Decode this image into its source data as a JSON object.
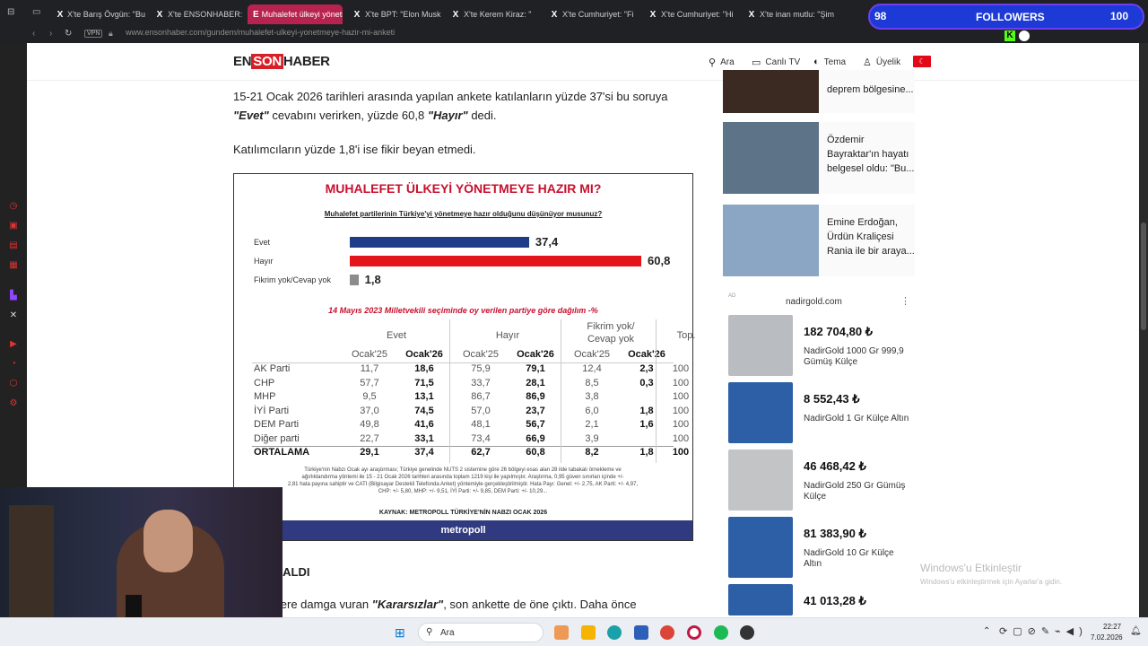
{
  "tabs": [
    {
      "label": "X'te Barış Övgün: \"Bu",
      "icon": "X",
      "active": false
    },
    {
      "label": "X'te ENSONHABER:",
      "icon": "X",
      "active": false
    },
    {
      "label": "Muhalefet ülkeyi yönetm",
      "icon": "E",
      "active": true
    },
    {
      "label": "X'te BPT: \"Elon Musk",
      "icon": "X",
      "active": false
    },
    {
      "label": "X'te Kerem Kiraz: \"",
      "icon": "X",
      "active": false
    },
    {
      "label": "X'te Cumhuriyet: \"Fi",
      "icon": "X",
      "active": false
    },
    {
      "label": "X'te Cumhuriyet: \"Hi",
      "icon": "X",
      "active": false
    },
    {
      "label": "X'te inan mutlu: \"Şim",
      "icon": "X",
      "active": false
    }
  ],
  "address": {
    "vpn": "VPN",
    "url": "www.ensonhaber.com/gundem/muhalefet-ulkeyi-yonetmeye-hazir-mi-anketi"
  },
  "header": {
    "logo": {
      "part1": "EN",
      "part2": "SON",
      "part3": "HABER"
    },
    "nav": [
      {
        "icon": "search-icon",
        "glyph": "⚲",
        "label": "Ara"
      },
      {
        "icon": "tv-icon",
        "glyph": "▭",
        "label": "Canlı TV"
      },
      {
        "icon": "theme-icon",
        "glyph": "◐",
        "label": "Tema"
      },
      {
        "icon": "user-icon",
        "glyph": "♙",
        "label": "Üyelik"
      }
    ],
    "flag": "☾"
  },
  "article": {
    "p1_line1": "15-21 Ocak 2026 tarihleri arasında yapılan ankete katılanların yüzde 37'si bu soruya",
    "p1_yes": "\"Evet\"",
    "p1_mid": " cevabını verirken, yüzde 60,8 ",
    "p1_no": "\"Hayır\"",
    "p1_end": " dedi.",
    "p2": "Katılımcıların yüzde 1,8'i ise fikir beyan etmedi.",
    "subhead": "ZLAR AZALDI",
    "p3_start": "an anketlere damga vuran ",
    "p3_bold": "\"Kararsızlar\"",
    "p3_end": ", son ankette de öne çıktı. Daha önce"
  },
  "figure": {
    "title": "MUHALEFET ÜLKEYİ YÖNETMEYE HAZIR MI?",
    "question": "Muhalefet partilerinin Türkiye'yi yönetmeye hazır olduğunu düşünüyor musunuz?",
    "subtitle": "14 Mayıs 2023 Milletvekili seçiminde oy verilen partiye göre dağılım -%",
    "groups": [
      "Evet",
      "Hayır",
      "Fikrim yok/\nCevap yok",
      "Top."
    ],
    "cols": [
      "Ocak'25",
      "Ocak'26",
      "Ocak'25",
      "Ocak'26",
      "Ocak'25",
      "Ocak'26"
    ],
    "rows": [
      {
        "label": "AK Parti",
        "values": [
          "11,7",
          "18,6",
          "75,9",
          "79,1",
          "12,4",
          "2,3",
          "100"
        ]
      },
      {
        "label": "CHP",
        "values": [
          "57,7",
          "71,5",
          "33,7",
          "28,1",
          "8,5",
          "0,3",
          "100"
        ]
      },
      {
        "label": "MHP",
        "values": [
          "9,5",
          "13,1",
          "86,7",
          "86,9",
          "3,8",
          "",
          "100"
        ]
      },
      {
        "label": "İYİ Parti",
        "values": [
          "37,0",
          "74,5",
          "57,0",
          "23,7",
          "6,0",
          "1,8",
          "100"
        ]
      },
      {
        "label": "DEM Parti",
        "values": [
          "49,8",
          "41,6",
          "48,1",
          "56,7",
          "2,1",
          "1,6",
          "100"
        ]
      },
      {
        "label": "Diğer parti",
        "values": [
          "22,7",
          "33,1",
          "73,4",
          "66,9",
          "3,9",
          "",
          "100"
        ]
      },
      {
        "label": "ORTALAMA",
        "values": [
          "29,1",
          "37,4",
          "62,7",
          "60,8",
          "8,2",
          "1,8",
          "100"
        ]
      }
    ],
    "note_line1": "Türkiye'nin Nabzı Ocak ayı araştırması; Türkiye genelinde NUTS 2 sistemine göre 26 bölgeyi esas alan 28 ilde tabakalı örnekleme ve",
    "note_line2": "ağırlıklandırma yöntemi ile 15 - 21 Ocak 2026 tarihleri arasında toplam 1219 kişi ile yapılmıştır. Araştırma, 0,95 güven sınırları içinde +/-",
    "note_line3": "2,81 hata payına sahiptir ve CATI (Bilgisayar Destekli Telefonda Anket) yöntemiyle gerçekleştirilmiştir. Hata Payı: Genel: +/- 2,75, AK Parti: +/- 4,97,",
    "note_line4": "CHP: +/- 5,80, MHP: +/- 9,51, İYİ Parti: +/- 9,85, DEM Parti: +/- 10,29...",
    "source": "KAYNAK: METROPOLL TÜRKİYE'NİN NABZI OCAK 2026",
    "brand": "metropoll"
  },
  "chart_data": {
    "type": "bar",
    "orientation": "horizontal",
    "title": "MUHALEFET ÜLKEYİ YÖNETMEYE HAZIR MI?",
    "categories": [
      "Evet",
      "Hayır",
      "Fikrim yok/Cevap yok"
    ],
    "values": [
      37.4,
      60.8,
      1.8
    ],
    "value_labels": [
      "37,4",
      "60,8",
      "1,8"
    ],
    "colors": [
      "#1f3c88",
      "#e3151a",
      "#8c8c8c"
    ]
  },
  "sidebar": {
    "stories": [
      {
        "title": "deprem bölgesine...",
        "thumb": "#3a2a22"
      },
      {
        "title": "Özdemir Bayraktar'ın hayatı belgesel oldu: \"Bu...",
        "thumb": "#5d7388"
      },
      {
        "title": "Emine Erdoğan, Ürdün Kraliçesi Rania ile bir araya...",
        "thumb": "#8aa6c4"
      }
    ],
    "ad": {
      "label": "AD",
      "domain": "nadirgold.com",
      "items": [
        {
          "price": "182 704,80 ₺",
          "name": "NadirGold 1000 Gr 999,9 Gümüş Külçe",
          "color": "#b9bcc0"
        },
        {
          "price": "8 552,43 ₺",
          "name": "NadirGold 1 Gr Külçe Altın",
          "color": "#2d5fa6"
        },
        {
          "price": "46 468,42 ₺",
          "name": "NadirGold 250 Gr Gümüş Külçe",
          "color": "#c2c4c6"
        },
        {
          "price": "81 383,90 ₺",
          "name": "NadirGold 10 Gr Külçe Altın",
          "color": "#2d5fa6"
        },
        {
          "price": "41 013,28 ₺",
          "name": "NadirGold 5 Gr Külçe",
          "color": "#2d5fa6"
        }
      ]
    }
  },
  "activation": {
    "line1": "Windows'u Etkinleştir",
    "line2": "Windows'u etkinleştirmek için Ayarlar'a gidin."
  },
  "taskbar": {
    "search_placeholder": "Ara",
    "time": "22:27",
    "date": "7.02.2026"
  },
  "overlay": {
    "left_num": "98",
    "label": "FOLLOWERS",
    "right_num": "100"
  }
}
